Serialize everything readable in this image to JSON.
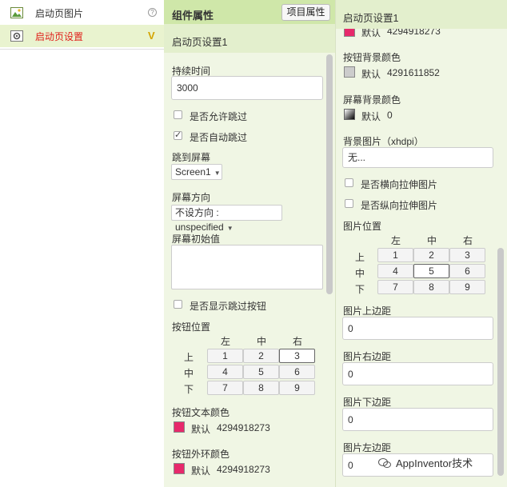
{
  "tree": {
    "items": [
      {
        "label": "启动页图片",
        "help": "?"
      },
      {
        "label": "启动页设置",
        "mark": "V"
      }
    ]
  },
  "middle": {
    "header_title": "组件属性",
    "project_button": "项目属性",
    "component_name": "启动页设置1",
    "duration": {
      "label": "持续时间",
      "value": "3000"
    },
    "allow_skip": {
      "label": "是否允许跳过",
      "checked": false
    },
    "auto_skip": {
      "label": "是否自动跳过",
      "checked": true
    },
    "jump_screen": {
      "label": "跳到屏幕",
      "value": "Screen1"
    },
    "orientation": {
      "label": "屏幕方向",
      "value": "不设方向 : unspecified"
    },
    "init_value": {
      "label": "屏幕初始值",
      "value": ""
    },
    "show_skip_button": {
      "label": "是否显示跳过按钮",
      "checked": false
    },
    "button_position": {
      "label": "按钮位置",
      "cols": [
        "左",
        "中",
        "右"
      ],
      "rows": [
        "上",
        "中",
        "下"
      ],
      "cells": [
        "1",
        "2",
        "3",
        "4",
        "5",
        "6",
        "7",
        "8",
        "9"
      ],
      "selected": "3"
    },
    "text_color": {
      "label": "按钮文本颜色",
      "default_label": "默认",
      "value": "4294918273",
      "color": "#e7296b"
    },
    "ring_color": {
      "label": "按钮外环颜色",
      "default_label": "默认",
      "value": "4294918273",
      "color": "#e7296b"
    }
  },
  "right": {
    "component_name": "启动页设置1",
    "cut_color": {
      "default_label": "默认",
      "value": "4294918273",
      "color": "#e7296b"
    },
    "button_bg_color": {
      "label": "按钮背景颜色",
      "default_label": "默认",
      "value": "4291611852",
      "color": "#cccccc"
    },
    "screen_bg_color": {
      "label": "屏幕背景颜色",
      "default_label": "默认",
      "value": "0"
    },
    "bg_image": {
      "label": "背景图片（xhdpi）",
      "value": "无..."
    },
    "stretch_h": {
      "label": "是否横向拉伸图片",
      "checked": false
    },
    "stretch_v": {
      "label": "是否纵向拉伸图片",
      "checked": false
    },
    "image_position": {
      "label": "图片位置",
      "cols": [
        "左",
        "中",
        "右"
      ],
      "rows": [
        "上",
        "中",
        "下"
      ],
      "cells": [
        "1",
        "2",
        "3",
        "4",
        "5",
        "6",
        "7",
        "8",
        "9"
      ],
      "selected": "5"
    },
    "margin_top": {
      "label": "图片上边距",
      "value": "0"
    },
    "margin_right": {
      "label": "图片右边距",
      "value": "0"
    },
    "margin_bottom": {
      "label": "图片下边距",
      "value": "0"
    },
    "margin_left": {
      "label": "图片左边距",
      "value": "0"
    }
  },
  "watermark": "AppInventor技术"
}
